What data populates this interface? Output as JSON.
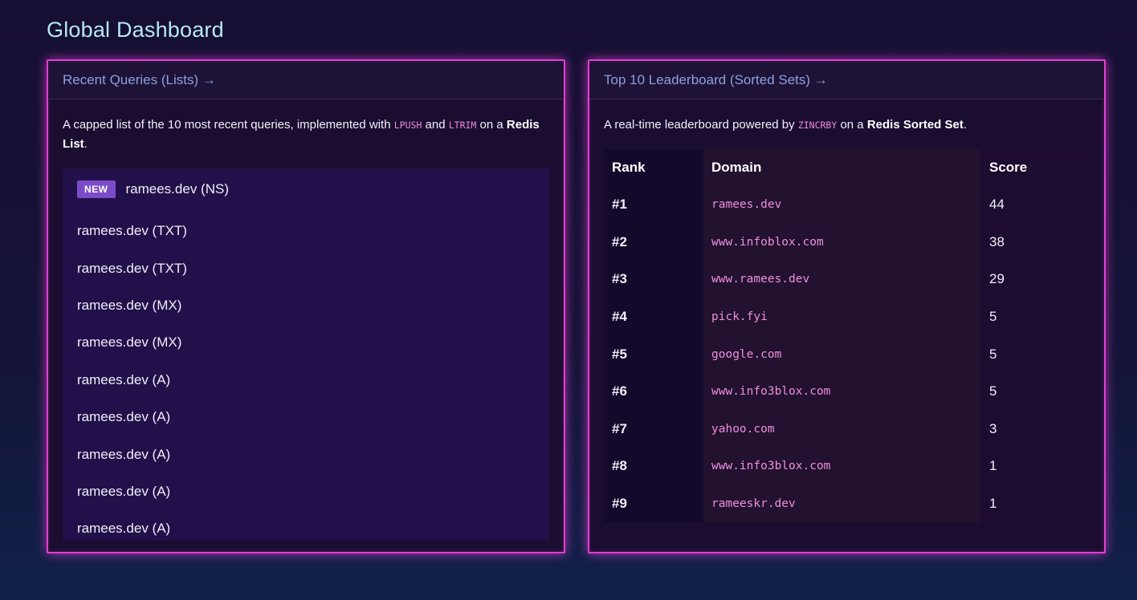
{
  "page": {
    "title": "Global Dashboard"
  },
  "recent_queries": {
    "header_link": "Recent Queries (Lists) →",
    "description": {
      "text1": "A capped list of the 10 most recent queries, implemented with ",
      "code1": "LPUSH",
      "text2": " and ",
      "code2": "LTRIM",
      "text3": " on a ",
      "bold": "Redis List",
      "text4": "."
    },
    "new_badge": "NEW",
    "items": [
      "ramees.dev (NS)",
      "ramees.dev (TXT)",
      "ramees.dev (TXT)",
      "ramees.dev (MX)",
      "ramees.dev (MX)",
      "ramees.dev (A)",
      "ramees.dev (A)",
      "ramees.dev (A)",
      "ramees.dev (A)",
      "ramees.dev (A)"
    ]
  },
  "leaderboard": {
    "header_link": "Top 10 Leaderboard (Sorted Sets) →",
    "description": {
      "text1": "A real-time leaderboard powered by ",
      "code1": "ZINCRBY",
      "text2": " on a ",
      "bold": "Redis Sorted Set",
      "text3": "."
    },
    "columns": {
      "rank": "Rank",
      "domain": "Domain",
      "score": "Score"
    },
    "rows": [
      {
        "rank": "#1",
        "domain": "ramees.dev",
        "score": "44"
      },
      {
        "rank": "#2",
        "domain": "www.infoblox.com",
        "score": "38"
      },
      {
        "rank": "#3",
        "domain": "www.ramees.dev",
        "score": "29"
      },
      {
        "rank": "#4",
        "domain": "pick.fyi",
        "score": "5"
      },
      {
        "rank": "#5",
        "domain": "google.com",
        "score": "5"
      },
      {
        "rank": "#6",
        "domain": "www.info3blox.com",
        "score": "5"
      },
      {
        "rank": "#7",
        "domain": "yahoo.com",
        "score": "3"
      },
      {
        "rank": "#8",
        "domain": "www.info3blox.com",
        "score": "1"
      },
      {
        "rank": "#9",
        "domain": "rameeskr.dev",
        "score": "1"
      }
    ]
  },
  "colors": {
    "accent_border": "#e23fd1",
    "title": "#b6e9f2",
    "link": "#8ea0dc",
    "code": "#f08adc",
    "badge": "#7a4cc8"
  }
}
